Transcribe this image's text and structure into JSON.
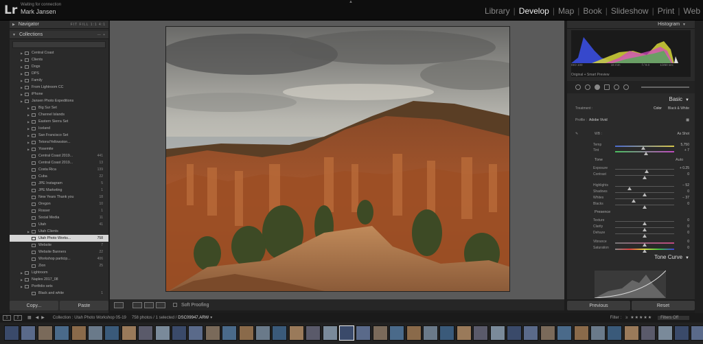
{
  "app": {
    "logo": "Lr",
    "status": "Waiting for connection",
    "user": "Mark Jansen",
    "modules": [
      "Library",
      "Develop",
      "Map",
      "Book",
      "Slideshow",
      "Print",
      "Web"
    ],
    "active_module": "Develop"
  },
  "left_panel": {
    "navigator": {
      "title": "Navigator",
      "zoom_options": "FIT  FILL  1:1  4:1"
    },
    "collections": {
      "title": "Collections",
      "items": [
        {
          "label": "Central Coast",
          "count": "",
          "indent": 1
        },
        {
          "label": "Clients",
          "count": "",
          "indent": 1
        },
        {
          "label": "Dogs",
          "count": "",
          "indent": 1
        },
        {
          "label": "DPS",
          "count": "",
          "indent": 1
        },
        {
          "label": "Family",
          "count": "",
          "indent": 1
        },
        {
          "label": "From Lightroom CC",
          "count": "",
          "indent": 1
        },
        {
          "label": "iPhone",
          "count": "",
          "indent": 1
        },
        {
          "label": "Jansen Photo Expeditions",
          "count": "",
          "indent": 1
        },
        {
          "label": "Big Sur Set",
          "count": "",
          "indent": 2
        },
        {
          "label": "Channel Islands",
          "count": "",
          "indent": 2
        },
        {
          "label": "Eastern Sierra Set",
          "count": "",
          "indent": 2
        },
        {
          "label": "Iceland",
          "count": "",
          "indent": 2
        },
        {
          "label": "San Francisco Set",
          "count": "",
          "indent": 2
        },
        {
          "label": "Tetons/Yellowston...",
          "count": "",
          "indent": 2
        },
        {
          "label": "Yosemite",
          "count": "",
          "indent": 2
        },
        {
          "label": "Central Coast 2019...",
          "count": "441",
          "indent": 2
        },
        {
          "label": "Central Coast 2019...",
          "count": "13",
          "indent": 2
        },
        {
          "label": "Costa Rica",
          "count": "139",
          "indent": 2
        },
        {
          "label": "Cuba",
          "count": "22",
          "indent": 2
        },
        {
          "label": "JPE Instagram",
          "count": "5",
          "indent": 2
        },
        {
          "label": "JPE Marketing",
          "count": "1",
          "indent": 2
        },
        {
          "label": "New Years Thank you",
          "count": "18",
          "indent": 2
        },
        {
          "label": "Oregon",
          "count": "10",
          "indent": 2
        },
        {
          "label": "Rosser",
          "count": "1",
          "indent": 2
        },
        {
          "label": "Social Media",
          "count": "11",
          "indent": 2
        },
        {
          "label": "Utah",
          "count": "41",
          "indent": 2
        },
        {
          "label": "Utah Clients",
          "count": "",
          "indent": 2
        },
        {
          "label": "Utah Photo Works...",
          "count": "758",
          "indent": 2,
          "selected": true
        },
        {
          "label": "Website",
          "count": "7",
          "indent": 2
        },
        {
          "label": "Website Banners",
          "count": "22",
          "indent": 2
        },
        {
          "label": "Workshop particip...",
          "count": "406",
          "indent": 2
        },
        {
          "label": "Zion",
          "count": "25",
          "indent": 2
        },
        {
          "label": "Lightroom",
          "count": "",
          "indent": 1
        },
        {
          "label": "Naples 2017_08",
          "count": "",
          "indent": 1
        },
        {
          "label": "Portfolio sets",
          "count": "",
          "indent": 1
        },
        {
          "label": "Black and white",
          "count": "1",
          "indent": 2
        }
      ]
    },
    "copy_label": "Copy...",
    "paste_label": "Paste"
  },
  "toolbar": {
    "soft_proofing": "Soft Proofing"
  },
  "right_panel": {
    "histogram_title": "Histogram",
    "histogram_info": {
      "iso": "ISO 100",
      "focal": "16 mm",
      "aperture": "f / 9.0",
      "shutter": "1/250 sec"
    },
    "preview": "Original + Smart Preview",
    "basic_title": "Basic",
    "treatment_label": "Treatment :",
    "treatment_color": "Color",
    "treatment_bw": "Black & White",
    "profile_label": "Profile :",
    "profile_value": "Adobe Vivid",
    "wb_label": "WB :",
    "wb_value": "As Shot",
    "tone_label": "Tone",
    "tone_auto": "Auto",
    "presence_label": "Presence",
    "sliders": [
      {
        "label": "Temp",
        "value": "5,750",
        "pos": 0.48,
        "group": "wb"
      },
      {
        "label": "Tint",
        "value": "+ 7",
        "pos": 0.52,
        "group": "wb"
      },
      {
        "label": "Exposure",
        "value": "+ 0.25",
        "pos": 0.53,
        "group": "tone"
      },
      {
        "label": "Contrast",
        "value": "0",
        "pos": 0.5,
        "group": "tone"
      },
      {
        "label": "Highlights",
        "value": "− 52",
        "pos": 0.24,
        "group": "tone"
      },
      {
        "label": "Shadows",
        "value": "0",
        "pos": 0.5,
        "group": "tone"
      },
      {
        "label": "Whites",
        "value": "− 37",
        "pos": 0.31,
        "group": "tone"
      },
      {
        "label": "Blacks",
        "value": "0",
        "pos": 0.5,
        "group": "tone"
      },
      {
        "label": "Texture",
        "value": "0",
        "pos": 0.5,
        "group": "presence"
      },
      {
        "label": "Clarity",
        "value": "0",
        "pos": 0.5,
        "group": "presence"
      },
      {
        "label": "Dehaze",
        "value": "0",
        "pos": 0.5,
        "group": "presence"
      },
      {
        "label": "Vibrance",
        "value": "0",
        "pos": 0.5,
        "group": "presence"
      },
      {
        "label": "Saturation",
        "value": "0",
        "pos": 0.5,
        "group": "presence"
      }
    ],
    "tone_curve_title": "Tone Curve",
    "previous_label": "Previous",
    "reset_label": "Reset"
  },
  "filmstrip": {
    "pages": [
      "1",
      "2"
    ],
    "collection": "Collection : Utah Photo Workshop 05-19",
    "count": "758 photos / 1 selected /",
    "filename": "DSC09947.ARW",
    "filter_label": "Filter :",
    "filter_value": "Filters Off"
  },
  "colors": {
    "accent": "#cfcfcf",
    "panel": "#2a2a2a",
    "selected_row": "#d6d6d6"
  }
}
